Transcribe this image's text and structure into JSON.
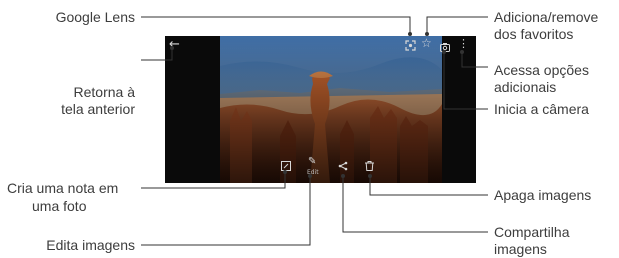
{
  "callouts": {
    "google_lens": "Google Lens",
    "back": [
      "Retorna à",
      "tela anterior"
    ],
    "note": [
      "Cria uma nota em",
      "uma foto"
    ],
    "edit": "Edita imagens",
    "favorites": [
      "Adiciona/remove",
      "dos favoritos"
    ],
    "more_options": [
      "Acessa opções",
      "adicionais"
    ],
    "camera": "Inicia a câmera",
    "delete": "Apaga imagens",
    "share": [
      "Compartilha",
      "imagens"
    ]
  },
  "toolbar": {
    "edit_caption": "Edit"
  },
  "icons": {
    "back": "arrow-left-icon",
    "lens": "google-lens-icon",
    "favorite": "star-icon",
    "camera": "camera-icon",
    "more": "more-vertical-icon",
    "note": "note-icon",
    "edit": "pencil-icon",
    "share": "share-icon",
    "delete": "trash-icon"
  },
  "colors": {
    "screen_bg": "#0a0a0a",
    "icon": "#d8d8d8",
    "callout_line": "#333333"
  }
}
